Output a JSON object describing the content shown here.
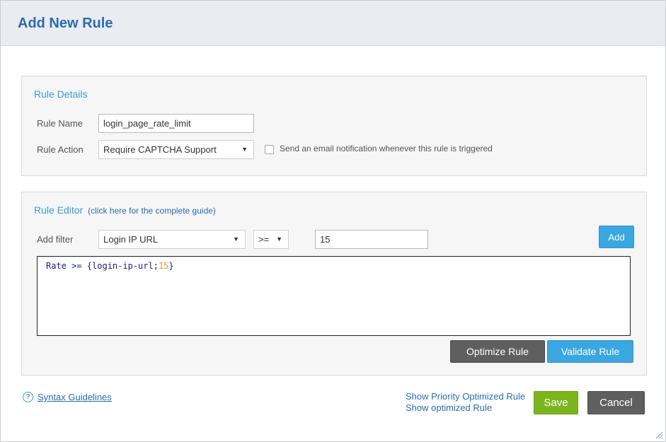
{
  "dialog": {
    "title": "Add New Rule"
  },
  "rule_details": {
    "heading": "Rule Details",
    "name_label": "Rule Name",
    "name_value": "login_page_rate_limit",
    "action_label": "Rule Action",
    "action_value": "Require CAPTCHA Support",
    "notify_checked": false,
    "notify_label": "Send an email notification whenever this rule is triggered"
  },
  "rule_editor": {
    "heading": "Rule Editor",
    "guide_link": "(click here for the complete guide)",
    "filter_label": "Add filter",
    "filter_value": "Login IP URL",
    "operator_value": ">=",
    "threshold_value": "15",
    "add_label": "Add",
    "code_prefix": "Rate >= {login-ip-url;",
    "code_number": "15",
    "code_suffix": "}",
    "optimize_label": "Optimize Rule",
    "validate_label": "Validate Rule"
  },
  "footer": {
    "help_icon": "?",
    "syntax_link": "Syntax Guidelines",
    "priority_link": "Show Priority Optimized Rule",
    "optimized_link": "Show optimized Rule",
    "save_label": "Save",
    "cancel_label": "Cancel"
  },
  "colors": {
    "accent_blue": "#3aa7e0",
    "title_blue": "#2b6cb0",
    "save_green": "#7ab51d",
    "dark_gray": "#5f5f5f"
  }
}
